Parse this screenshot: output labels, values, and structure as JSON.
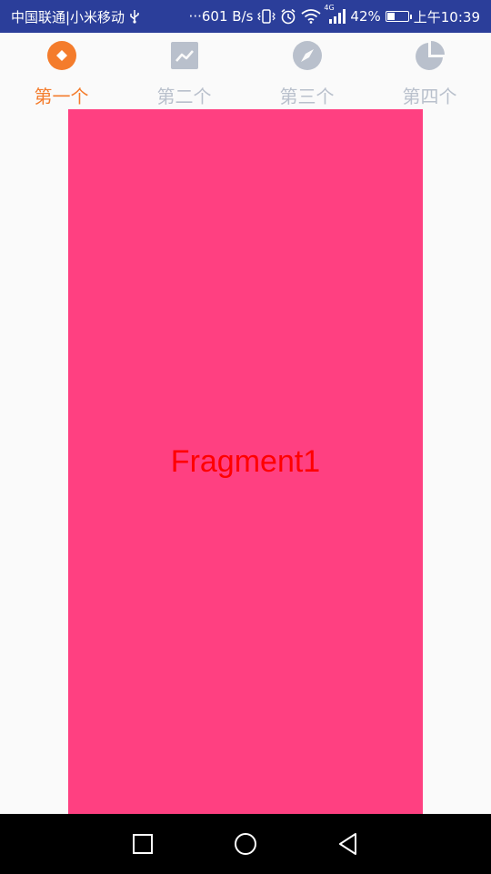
{
  "colors": {
    "status_bar_bg": "#2b3e9a",
    "tab_active": "#f47c2c",
    "tab_inactive": "#b9c0cc",
    "fragment_bg": "#ff4081",
    "fragment_text": "#ff0000",
    "nav_bar_bg": "#000000"
  },
  "status_bar": {
    "carrier": "中国联通|小米移动",
    "usb_icon": "usb-icon",
    "net_speed": "···601 B/s",
    "network_type": "4G",
    "battery_percent": "42%",
    "battery_level": 0.42,
    "time": "上午10:39"
  },
  "tabs": [
    {
      "label": "第一个",
      "icon": "diamond-circle-icon",
      "active": true
    },
    {
      "label": "第二个",
      "icon": "trend-chart-icon",
      "active": false
    },
    {
      "label": "第三个",
      "icon": "compass-icon",
      "active": false
    },
    {
      "label": "第四个",
      "icon": "pie-chart-icon",
      "active": false
    }
  ],
  "fragment": {
    "text": "Fragment1"
  },
  "nav_bar": {
    "recents": "square-icon",
    "home": "circle-icon",
    "back": "triangle-back-icon"
  }
}
